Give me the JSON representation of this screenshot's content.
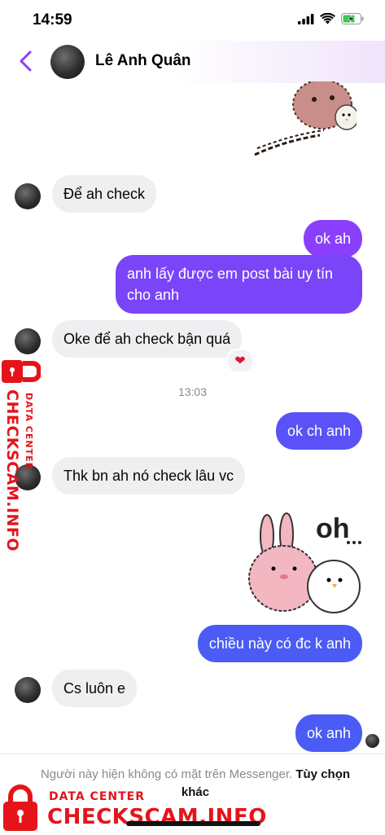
{
  "status_bar": {
    "time": "14:59"
  },
  "header": {
    "contact_name": "Lê Anh Quân"
  },
  "messages": [
    {
      "text": "Để ah check"
    },
    {
      "text": "ok ah"
    },
    {
      "text": "anh lấy được em post bài uy tín cho anh"
    },
    {
      "text": "Oke để ah check bận quá"
    },
    {
      "text": "ok ch anh"
    },
    {
      "text": "Thk bn ah nó check lâu vc"
    },
    {
      "text": "chiều này có đc k anh"
    },
    {
      "text": "Cs luôn e"
    },
    {
      "text": "ok anh"
    }
  ],
  "timestamp": "13:03",
  "reaction": "❤",
  "sticker_text": "oh",
  "footer": {
    "notice": "Người này hiện không có mặt trên Messenger.",
    "action": "Tùy chọn khác"
  },
  "watermark": {
    "line1": "DATA CENTER",
    "line2": "CHECKSCAM.INFO"
  },
  "colors": {
    "outgoing_top": "#8a3ffc",
    "outgoing_bottom": "#4a5cf5",
    "incoming": "#efeff1",
    "accent": "#8a3ffc",
    "watermark": "#e5141b"
  }
}
